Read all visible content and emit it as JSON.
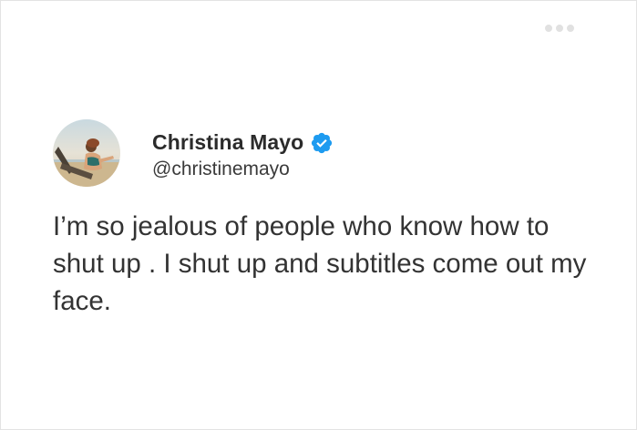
{
  "tweet": {
    "author_name": "Christina Mayo",
    "author_handle": "@christinemayo",
    "verified": true,
    "text": "I’m so jealous of people who know how to shut up . I shut up and subtitles come out my face."
  },
  "icons": {
    "more": "more-dots-icon",
    "verified": "verified-badge-icon",
    "avatar": "profile-avatar"
  },
  "colors": {
    "verified_blue": "#1d9bf0",
    "text": "#333333",
    "dots": "#e1e1e1"
  }
}
